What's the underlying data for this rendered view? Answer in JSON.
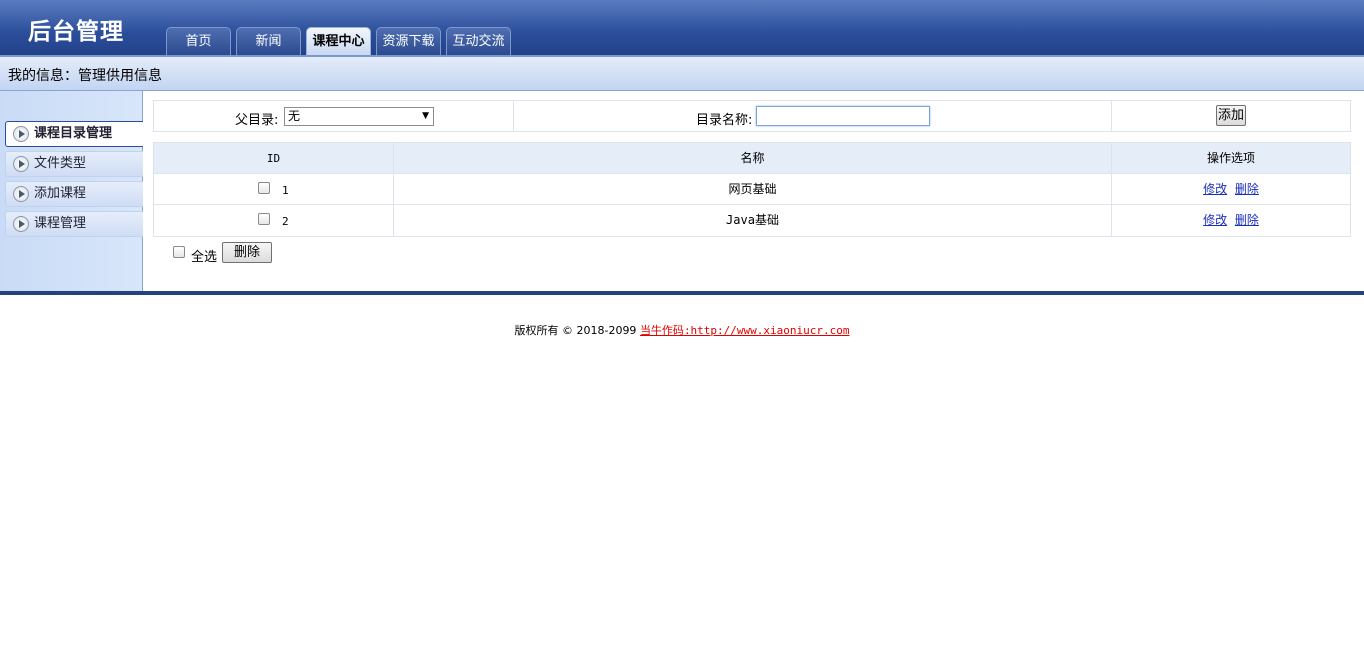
{
  "header": {
    "title": "后台管理",
    "tabs": [
      {
        "label": "首页"
      },
      {
        "label": "新闻"
      },
      {
        "label": "课程中心"
      },
      {
        "label": "资源下载"
      },
      {
        "label": "互动交流"
      }
    ]
  },
  "infobar": {
    "text": "我的信息：管理供用信息"
  },
  "sidebar": {
    "items": [
      {
        "label": "课程目录管理"
      },
      {
        "label": "文件类型"
      },
      {
        "label": "添加课程"
      },
      {
        "label": "课程管理"
      }
    ]
  },
  "form": {
    "parent_label": "父目录:",
    "parent_value": "无",
    "name_label": "目录名称:",
    "name_value": "",
    "add_button": "添加"
  },
  "table": {
    "headers": [
      "ID",
      "名称",
      "操作选项"
    ],
    "rows": [
      {
        "id": "1",
        "name": "网页基础",
        "edit": "修改",
        "delete": "删除"
      },
      {
        "id": "2",
        "name": "Java基础",
        "edit": "修改",
        "delete": "删除"
      }
    ],
    "select_all": "全选",
    "delete_button": "删除"
  },
  "footer": {
    "copyright": "版权所有 © 2018-2099",
    "link_cn": "当牛作码",
    "link_url": ":http://www.xiaoniucr.com"
  },
  "colors": {
    "header_blue": "#2b4e9a",
    "footer_link": "#e00000"
  }
}
